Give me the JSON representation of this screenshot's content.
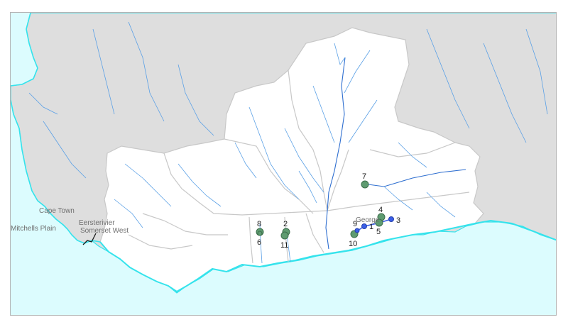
{
  "map": {
    "colors": {
      "sea": "#dcfcfe",
      "coastline": "#35e3ec",
      "land_outside": "#dedede",
      "region": "#ffffff",
      "region_border": "#c8c8c8",
      "river": "#5aa0e6",
      "site": "#5e9b70",
      "station": "#3a5ee8"
    },
    "towns": [
      {
        "id": "cape-town",
        "label": "Cape Town"
      },
      {
        "id": "mitchells-plain",
        "label": "Mitchells Plain"
      },
      {
        "id": "eersterivier",
        "label": "Eersterivier"
      },
      {
        "id": "somerset-west",
        "label": "Somerset West"
      },
      {
        "id": "george",
        "label": "George"
      }
    ],
    "sites": [
      {
        "id": "1",
        "label": "1"
      },
      {
        "id": "2",
        "label": "2"
      },
      {
        "id": "3",
        "label": "3"
      },
      {
        "id": "4",
        "label": "4"
      },
      {
        "id": "5",
        "label": "5"
      },
      {
        "id": "6",
        "label": "6"
      },
      {
        "id": "7",
        "label": "7"
      },
      {
        "id": "8",
        "label": "8"
      },
      {
        "id": "9",
        "label": "9"
      },
      {
        "id": "10",
        "label": "10"
      },
      {
        "id": "11",
        "label": "11"
      }
    ]
  }
}
